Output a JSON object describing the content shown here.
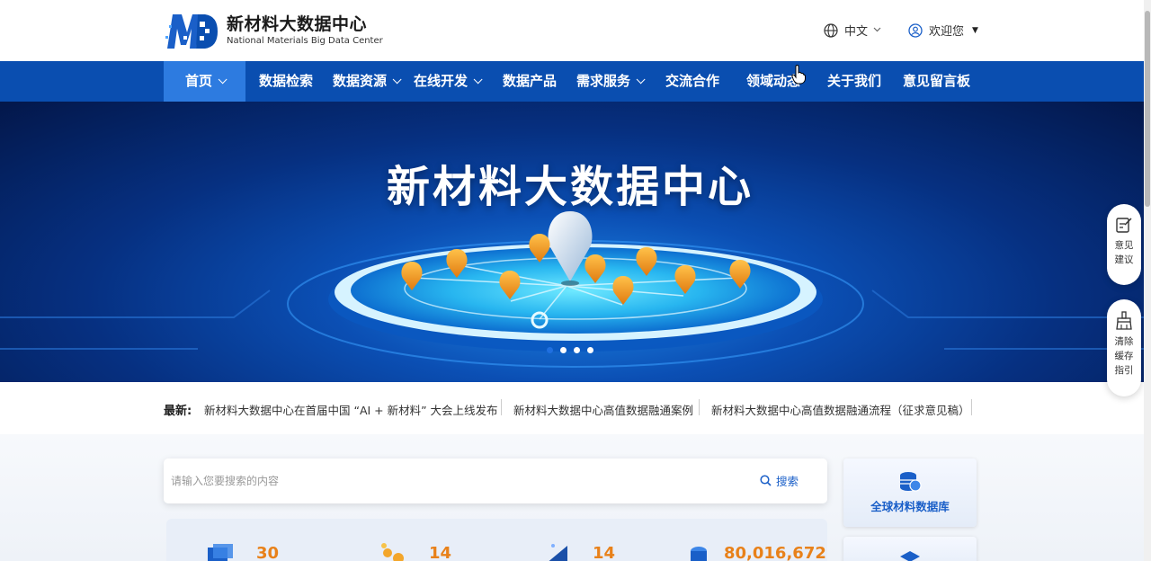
{
  "header": {
    "logo_cn": "新材料大数据中心",
    "logo_en": "National Materials Big Data Center",
    "language": "中文",
    "user": "欢迎您"
  },
  "nav": {
    "items": [
      {
        "label": "首页",
        "dropdown": true,
        "active": true
      },
      {
        "label": "数据检索",
        "dropdown": false
      },
      {
        "label": "数据资源",
        "dropdown": true
      },
      {
        "label": "在线开发",
        "dropdown": true
      },
      {
        "label": "数据产品",
        "dropdown": false
      },
      {
        "label": "需求服务",
        "dropdown": true
      },
      {
        "label": "交流合作",
        "dropdown": false
      },
      {
        "label": "领域动态",
        "dropdown": false
      },
      {
        "label": "关于我们",
        "dropdown": false
      },
      {
        "label": "意见留言板",
        "dropdown": false
      }
    ]
  },
  "banner": {
    "title": "新材料大数据中心",
    "slides": 4,
    "current_slide": 1
  },
  "news": {
    "label": "最新:",
    "items": [
      "新材料大数据中心在首届中国 “AI + 新材料” 大会上线发布",
      "新材料大数据中心高值数据融通案例",
      "新材料大数据中心高值数据融通流程（征求意见稿）"
    ]
  },
  "search": {
    "placeholder": "请输入您要搜索的内容",
    "button": "搜索"
  },
  "stats": [
    "30",
    "14",
    "14",
    "80,016,672"
  ],
  "side_cards": [
    {
      "label": "全球材料数据库"
    },
    {
      "label": ""
    }
  ],
  "float_buttons": {
    "feedback": [
      "意见",
      "建议"
    ],
    "clear_cache": [
      "清除",
      "缓存",
      "指引"
    ]
  },
  "colors": {
    "nav_bg": "#0a4eb0",
    "nav_active": "#2d7be0",
    "accent_orange": "#e8811a",
    "link_blue": "#1a5fc8"
  }
}
